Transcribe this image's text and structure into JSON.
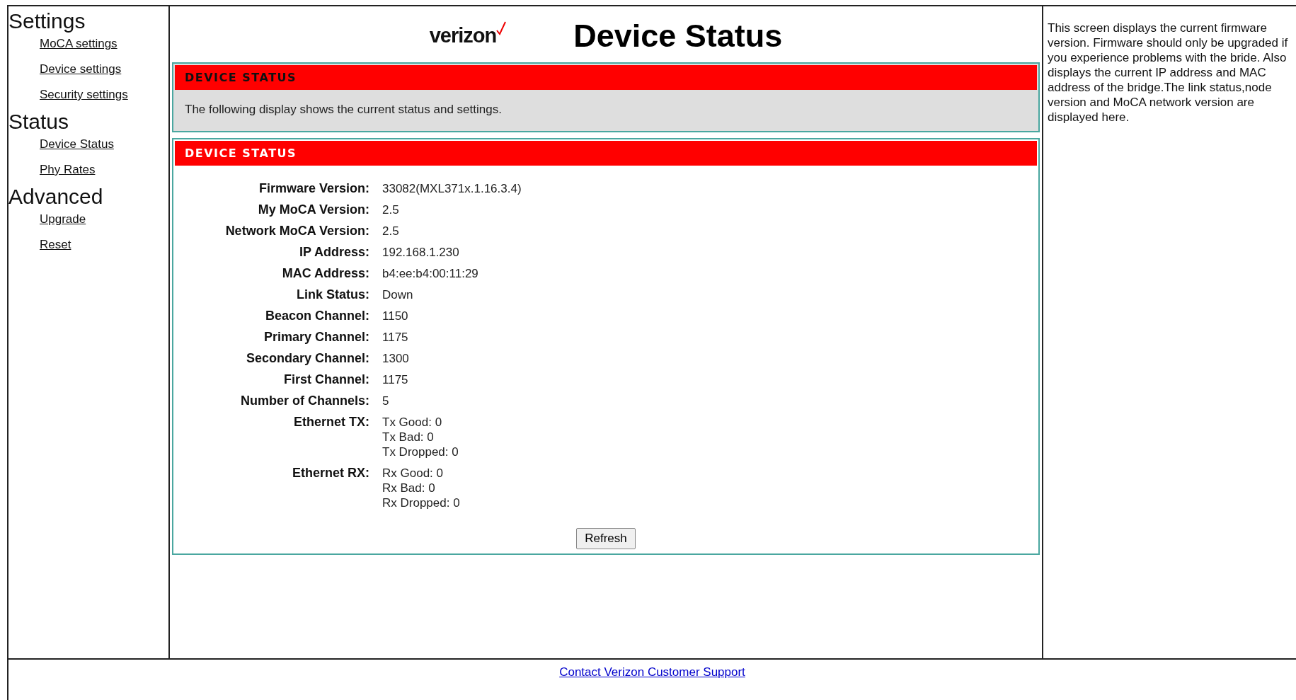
{
  "sidebar": {
    "sections": [
      {
        "heading": "Settings",
        "links": [
          "MoCA settings",
          "Device settings",
          "Security settings"
        ]
      },
      {
        "heading": "Status",
        "links": [
          "Device Status",
          "Phy Rates"
        ]
      },
      {
        "heading": "Advanced",
        "links": [
          "Upgrade",
          "Reset"
        ]
      }
    ]
  },
  "header": {
    "logo": "verizon",
    "title": "Device Status"
  },
  "intro_panel": {
    "heading": "DEVICE STATUS",
    "text": "The following display shows the current status and settings."
  },
  "status_panel": {
    "heading": "DEVICE STATUS",
    "rows": [
      {
        "label": "Firmware Version:",
        "values": [
          "33082(MXL371x.1.16.3.4)"
        ]
      },
      {
        "label": "My MoCA Version:",
        "values": [
          "2.5"
        ]
      },
      {
        "label": "Network MoCA Version:",
        "values": [
          "2.5"
        ]
      },
      {
        "label": "IP Address:",
        "values": [
          "192.168.1.230"
        ]
      },
      {
        "label": "MAC Address:",
        "values": [
          "b4:ee:b4:00:11:29"
        ]
      },
      {
        "label": "Link Status:",
        "values": [
          "Down"
        ]
      },
      {
        "label": "Beacon Channel:",
        "values": [
          "1150"
        ]
      },
      {
        "label": "Primary Channel:",
        "values": [
          "1175"
        ]
      },
      {
        "label": "Secondary Channel:",
        "values": [
          "1300"
        ]
      },
      {
        "label": "First Channel:",
        "values": [
          "1175"
        ]
      },
      {
        "label": "Number of Channels:",
        "values": [
          "5"
        ]
      },
      {
        "label": "Ethernet TX:",
        "values": [
          "Tx Good: 0",
          "Tx Bad: 0",
          "Tx Dropped: 0"
        ]
      },
      {
        "label": "Ethernet RX:",
        "values": [
          "Rx Good: 0",
          "Rx Bad: 0",
          "Rx Dropped: 0"
        ]
      }
    ],
    "button": "Refresh"
  },
  "help_text": "This screen displays the current firmware version. Firmware should only be upgraded if you experience problems with the bride. Also displays the current IP address and MAC address of the bridge.The link status,node version and MoCA network version are displayed here.",
  "footer": {
    "link": "Contact Verizon Customer Support"
  }
}
